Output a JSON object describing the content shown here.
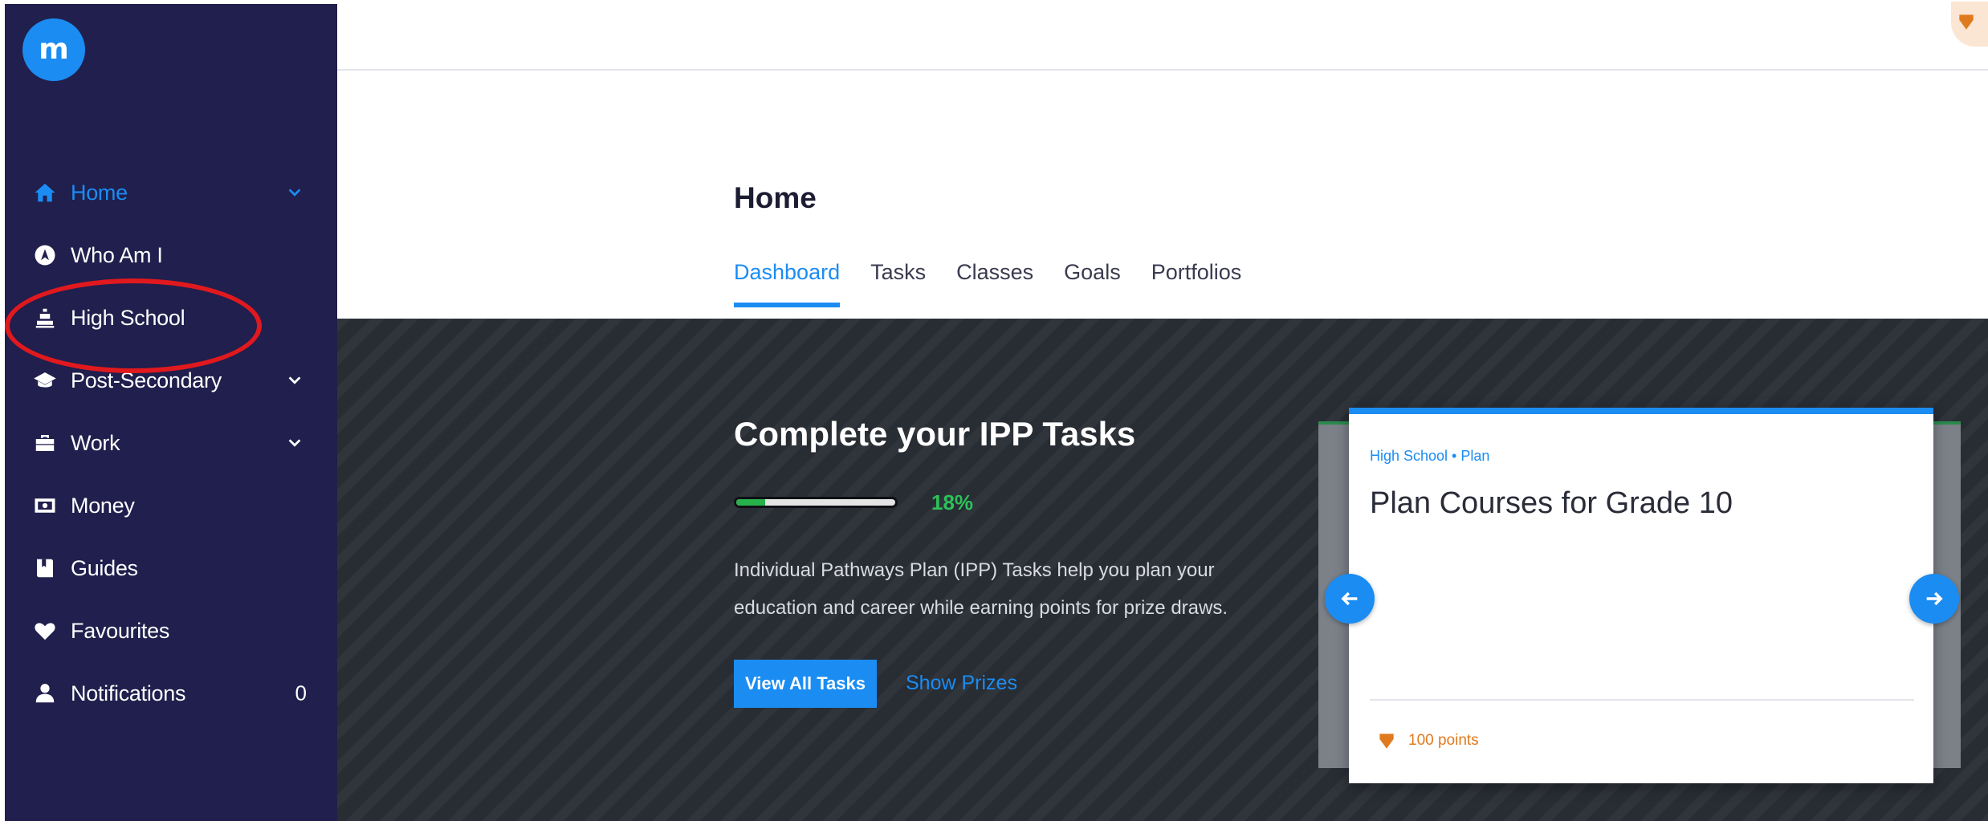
{
  "app": {
    "logo_text": "m"
  },
  "sidebar": {
    "items": [
      {
        "label": "Home",
        "icon": "home-icon",
        "active": true,
        "chevron": true
      },
      {
        "label": "Who Am I",
        "icon": "compass-icon"
      },
      {
        "label": "High School",
        "icon": "school-bell-icon"
      },
      {
        "label": "Post-Secondary",
        "icon": "graduation-cap-icon",
        "chevron": true
      },
      {
        "label": "Work",
        "icon": "briefcase-icon",
        "chevron": true
      },
      {
        "label": "Money",
        "icon": "money-icon"
      },
      {
        "label": "Guides",
        "icon": "book-icon"
      },
      {
        "label": "Favourites",
        "icon": "heart-icon"
      },
      {
        "label": "Notifications",
        "icon": "bell-icon",
        "count": "0"
      }
    ]
  },
  "header": {
    "title": "Home",
    "tabs": [
      "Dashboard",
      "Tasks",
      "Classes",
      "Goals",
      "Portfolios"
    ],
    "active_tab": "Dashboard"
  },
  "banner": {
    "title": "Complete your IPP Tasks",
    "progress": 0.18,
    "progress_text": "18%",
    "description": "Individual Pathways Plan (IPP) Tasks help you plan your education and career while earning points for prize draws.",
    "primary_button": "View All Tasks",
    "secondary_link": "Show Prizes"
  },
  "card": {
    "breadcrumb": "High School • Plan",
    "title": "Plan Courses for Grade 10",
    "points": "100 points"
  },
  "colors": {
    "accent": "#1b8cf2",
    "sidebar_bg": "#201f4d",
    "banner_bg": "#282d34",
    "progress": "#2cc258",
    "points": "#e07a1f",
    "highlight_ring": "#e0191e"
  }
}
